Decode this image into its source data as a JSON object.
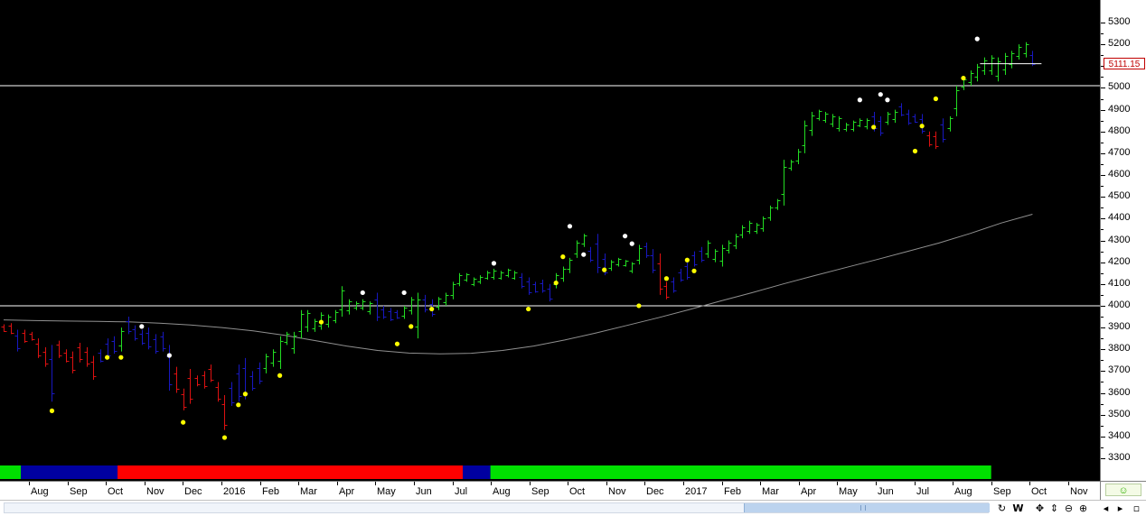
{
  "chart_data": {
    "type": "ohlc",
    "ylim": [
      3300,
      5340
    ],
    "y_ticks": [
      3300,
      3400,
      3500,
      3600,
      3700,
      3800,
      3900,
      4000,
      4100,
      4200,
      4300,
      4400,
      4500,
      4600,
      4700,
      4800,
      4900,
      5000,
      5100,
      5200,
      5300
    ],
    "x_labels": [
      "Aug",
      "Sep",
      "Oct",
      "Nov",
      "Dec",
      "2016",
      "Feb",
      "Mar",
      "Apr",
      "May",
      "Jun",
      "Jul",
      "Aug",
      "Sep",
      "Oct",
      "Nov",
      "Dec",
      "2017",
      "Feb",
      "Mar",
      "Apr",
      "May",
      "Jun",
      "Jul",
      "Aug",
      "Sep",
      "Oct",
      "Nov"
    ],
    "horizontal_lines": [
      4000,
      5010
    ],
    "last_price_label": "5111.15",
    "last_price": 5111.15,
    "colors": {
      "up": "#22dd22",
      "down": "#dd1111",
      "neutral": "#1818c0",
      "ma": "#909090",
      "sar_bull": "#ffff00",
      "sar_bear": "#ffffff",
      "hline": "#ffffff"
    },
    "bars": [
      {
        "h": 3915,
        "l": 3880,
        "d": "d"
      },
      {
        "h": 3920,
        "l": 3870,
        "d": "d"
      },
      {
        "h": 3890,
        "l": 3790,
        "d": "n"
      },
      {
        "h": 3890,
        "l": 3830,
        "d": "d"
      },
      {
        "h": 3880,
        "l": 3840,
        "d": "d"
      },
      {
        "h": 3850,
        "l": 3760,
        "d": "d"
      },
      {
        "h": 3810,
        "l": 3720,
        "d": "d"
      },
      {
        "h": 3820,
        "l": 3560,
        "d": "n"
      },
      {
        "h": 3840,
        "l": 3760,
        "d": "d"
      },
      {
        "h": 3800,
        "l": 3740,
        "d": "d"
      },
      {
        "h": 3790,
        "l": 3690,
        "d": "d"
      },
      {
        "h": 3830,
        "l": 3740,
        "d": "d"
      },
      {
        "h": 3810,
        "l": 3720,
        "d": "d"
      },
      {
        "h": 3770,
        "l": 3660,
        "d": "d"
      },
      {
        "h": 3800,
        "l": 3740,
        "d": "n"
      },
      {
        "h": 3850,
        "l": 3760,
        "d": "n"
      },
      {
        "h": 3860,
        "l": 3780,
        "d": "n"
      },
      {
        "h": 3900,
        "l": 3790,
        "d": "u"
      },
      {
        "h": 3950,
        "l": 3870,
        "d": "n"
      },
      {
        "h": 3910,
        "l": 3840,
        "d": "n"
      },
      {
        "h": 3890,
        "l": 3820,
        "d": "n"
      },
      {
        "h": 3900,
        "l": 3800,
        "d": "n"
      },
      {
        "h": 3870,
        "l": 3780,
        "d": "n"
      },
      {
        "h": 3880,
        "l": 3790,
        "d": "n"
      },
      {
        "h": 3820,
        "l": 3610,
        "d": "n"
      },
      {
        "h": 3720,
        "l": 3600,
        "d": "d"
      },
      {
        "h": 3620,
        "l": 3520,
        "d": "d"
      },
      {
        "h": 3710,
        "l": 3550,
        "d": "d"
      },
      {
        "h": 3680,
        "l": 3630,
        "d": "d"
      },
      {
        "h": 3700,
        "l": 3620,
        "d": "d"
      },
      {
        "h": 3730,
        "l": 3650,
        "d": "d"
      },
      {
        "h": 3650,
        "l": 3560,
        "d": "d"
      },
      {
        "h": 3590,
        "l": 3430,
        "d": "d"
      },
      {
        "h": 3650,
        "l": 3540,
        "d": "n"
      },
      {
        "h": 3730,
        "l": 3560,
        "d": "n"
      },
      {
        "h": 3760,
        "l": 3570,
        "d": "n"
      },
      {
        "h": 3700,
        "l": 3610,
        "d": "n"
      },
      {
        "h": 3740,
        "l": 3640,
        "d": "n"
      },
      {
        "h": 3780,
        "l": 3690,
        "d": "u"
      },
      {
        "h": 3800,
        "l": 3720,
        "d": "u"
      },
      {
        "h": 3860,
        "l": 3710,
        "d": "u"
      },
      {
        "h": 3880,
        "l": 3820,
        "d": "u"
      },
      {
        "h": 3880,
        "l": 3780,
        "d": "u"
      },
      {
        "h": 3980,
        "l": 3850,
        "d": "u"
      },
      {
        "h": 3980,
        "l": 3880,
        "d": "u"
      },
      {
        "h": 3940,
        "l": 3880,
        "d": "u"
      },
      {
        "h": 3970,
        "l": 3890,
        "d": "u"
      },
      {
        "h": 3960,
        "l": 3900,
        "d": "u"
      },
      {
        "h": 3980,
        "l": 3920,
        "d": "u"
      },
      {
        "h": 4090,
        "l": 3950,
        "d": "u"
      },
      {
        "h": 4030,
        "l": 3960,
        "d": "u"
      },
      {
        "h": 4020,
        "l": 3980,
        "d": "u"
      },
      {
        "h": 4030,
        "l": 3980,
        "d": "u"
      },
      {
        "h": 4020,
        "l": 3960,
        "d": "u"
      },
      {
        "h": 4060,
        "l": 3930,
        "d": "n"
      },
      {
        "h": 4000,
        "l": 3940,
        "d": "n"
      },
      {
        "h": 3990,
        "l": 3930,
        "d": "n"
      },
      {
        "h": 3980,
        "l": 3940,
        "d": "n"
      },
      {
        "h": 4000,
        "l": 3940,
        "d": "u"
      },
      {
        "h": 4040,
        "l": 3960,
        "d": "u"
      },
      {
        "h": 4060,
        "l": 3850,
        "d": "u"
      },
      {
        "h": 4050,
        "l": 3970,
        "d": "n"
      },
      {
        "h": 4030,
        "l": 3950,
        "d": "n"
      },
      {
        "h": 4040,
        "l": 3980,
        "d": "u"
      },
      {
        "h": 4060,
        "l": 4000,
        "d": "u"
      },
      {
        "h": 4110,
        "l": 4030,
        "d": "u"
      },
      {
        "h": 4150,
        "l": 4090,
        "d": "u"
      },
      {
        "h": 4150,
        "l": 4110,
        "d": "u"
      },
      {
        "h": 4130,
        "l": 4090,
        "d": "u"
      },
      {
        "h": 4140,
        "l": 4100,
        "d": "u"
      },
      {
        "h": 4160,
        "l": 4120,
        "d": "u"
      },
      {
        "h": 4170,
        "l": 4120,
        "d": "u"
      },
      {
        "h": 4160,
        "l": 4120,
        "d": "u"
      },
      {
        "h": 4170,
        "l": 4130,
        "d": "u"
      },
      {
        "h": 4160,
        "l": 4120,
        "d": "u"
      },
      {
        "h": 4150,
        "l": 4080,
        "d": "n"
      },
      {
        "h": 4130,
        "l": 4050,
        "d": "n"
      },
      {
        "h": 4110,
        "l": 4060,
        "d": "n"
      },
      {
        "h": 4120,
        "l": 4060,
        "d": "n"
      },
      {
        "h": 4100,
        "l": 4020,
        "d": "n"
      },
      {
        "h": 4150,
        "l": 4080,
        "d": "u"
      },
      {
        "h": 4180,
        "l": 4110,
        "d": "u"
      },
      {
        "h": 4220,
        "l": 4150,
        "d": "u"
      },
      {
        "h": 4300,
        "l": 4220,
        "d": "u"
      },
      {
        "h": 4330,
        "l": 4270,
        "d": "u"
      },
      {
        "h": 4270,
        "l": 4200,
        "d": "n"
      },
      {
        "h": 4330,
        "l": 4150,
        "d": "n"
      },
      {
        "h": 4240,
        "l": 4140,
        "d": "n"
      },
      {
        "h": 4210,
        "l": 4160,
        "d": "u"
      },
      {
        "h": 4220,
        "l": 4180,
        "d": "u"
      },
      {
        "h": 4210,
        "l": 4180,
        "d": "u"
      },
      {
        "h": 4200,
        "l": 4150,
        "d": "u"
      },
      {
        "h": 4280,
        "l": 4190,
        "d": "u"
      },
      {
        "h": 4290,
        "l": 4220,
        "d": "n"
      },
      {
        "h": 4260,
        "l": 4150,
        "d": "n"
      },
      {
        "h": 4240,
        "l": 4050,
        "d": "d"
      },
      {
        "h": 4110,
        "l": 4030,
        "d": "d"
      },
      {
        "h": 4130,
        "l": 4060,
        "d": "n"
      },
      {
        "h": 4170,
        "l": 4110,
        "d": "n"
      },
      {
        "h": 4200,
        "l": 4120,
        "d": "n"
      },
      {
        "h": 4250,
        "l": 4180,
        "d": "n"
      },
      {
        "h": 4270,
        "l": 4200,
        "d": "n"
      },
      {
        "h": 4300,
        "l": 4220,
        "d": "u"
      },
      {
        "h": 4260,
        "l": 4200,
        "d": "u"
      },
      {
        "h": 4280,
        "l": 4180,
        "d": "u"
      },
      {
        "h": 4300,
        "l": 4240,
        "d": "u"
      },
      {
        "h": 4330,
        "l": 4260,
        "d": "u"
      },
      {
        "h": 4370,
        "l": 4310,
        "d": "u"
      },
      {
        "h": 4390,
        "l": 4330,
        "d": "u"
      },
      {
        "h": 4380,
        "l": 4330,
        "d": "u"
      },
      {
        "h": 4410,
        "l": 4340,
        "d": "u"
      },
      {
        "h": 4460,
        "l": 4390,
        "d": "u"
      },
      {
        "h": 4490,
        "l": 4440,
        "d": "u"
      },
      {
        "h": 4670,
        "l": 4460,
        "d": "u"
      },
      {
        "h": 4670,
        "l": 4620,
        "d": "u"
      },
      {
        "h": 4720,
        "l": 4650,
        "d": "u"
      },
      {
        "h": 4850,
        "l": 4700,
        "d": "u"
      },
      {
        "h": 4890,
        "l": 4780,
        "d": "u"
      },
      {
        "h": 4900,
        "l": 4850,
        "d": "u"
      },
      {
        "h": 4890,
        "l": 4840,
        "d": "u"
      },
      {
        "h": 4880,
        "l": 4820,
        "d": "u"
      },
      {
        "h": 4870,
        "l": 4800,
        "d": "u"
      },
      {
        "h": 4840,
        "l": 4800,
        "d": "u"
      },
      {
        "h": 4850,
        "l": 4800,
        "d": "u"
      },
      {
        "h": 4860,
        "l": 4820,
        "d": "u"
      },
      {
        "h": 4860,
        "l": 4810,
        "d": "u"
      },
      {
        "h": 4890,
        "l": 4800,
        "d": "n"
      },
      {
        "h": 4870,
        "l": 4780,
        "d": "n"
      },
      {
        "h": 4890,
        "l": 4830,
        "d": "u"
      },
      {
        "h": 4900,
        "l": 4840,
        "d": "u"
      },
      {
        "h": 4930,
        "l": 4870,
        "d": "n"
      },
      {
        "h": 4900,
        "l": 4830,
        "d": "n"
      },
      {
        "h": 4880,
        "l": 4840,
        "d": "n"
      },
      {
        "h": 4880,
        "l": 4790,
        "d": "n"
      },
      {
        "h": 4800,
        "l": 4730,
        "d": "d"
      },
      {
        "h": 4800,
        "l": 4720,
        "d": "d"
      },
      {
        "h": 4860,
        "l": 4750,
        "d": "n"
      },
      {
        "h": 4870,
        "l": 4800,
        "d": "u"
      },
      {
        "h": 5010,
        "l": 4870,
        "d": "u"
      },
      {
        "h": 5050,
        "l": 4990,
        "d": "u"
      },
      {
        "h": 5080,
        "l": 5010,
        "d": "u"
      },
      {
        "h": 5110,
        "l": 5030,
        "d": "u"
      },
      {
        "h": 5140,
        "l": 5060,
        "d": "u"
      },
      {
        "h": 5150,
        "l": 5060,
        "d": "u"
      },
      {
        "h": 5140,
        "l": 5030,
        "d": "u"
      },
      {
        "h": 5160,
        "l": 5060,
        "d": "u"
      },
      {
        "h": 5170,
        "l": 5090,
        "d": "u"
      },
      {
        "h": 5200,
        "l": 5130,
        "d": "u"
      },
      {
        "h": 5210,
        "l": 5140,
        "d": "u"
      },
      {
        "h": 5170,
        "l": 5100,
        "d": "n"
      }
    ],
    "moving_average": [
      3935,
      3932,
      3930,
      3928,
      3926,
      3920,
      3912,
      3900,
      3885,
      3865,
      3840,
      3815,
      3795,
      3783,
      3779,
      3782,
      3795,
      3815,
      3843,
      3875,
      3910,
      3945,
      3983,
      4022,
      4060,
      4100,
      4138,
      4175,
      4212,
      4250,
      4288,
      4332,
      4380,
      4420
    ],
    "sar_points": [
      {
        "i": 7,
        "v": 3518,
        "t": "bull"
      },
      {
        "i": 15,
        "v": 3763,
        "t": "bull"
      },
      {
        "i": 17,
        "v": 3763,
        "t": "bull"
      },
      {
        "i": 20,
        "v": 3905,
        "t": "bear"
      },
      {
        "i": 24,
        "v": 3772,
        "t": "bear"
      },
      {
        "i": 26,
        "v": 3465,
        "t": "bull"
      },
      {
        "i": 32,
        "v": 3395,
        "t": "bull"
      },
      {
        "i": 34,
        "v": 3545,
        "t": "bull"
      },
      {
        "i": 35,
        "v": 3595,
        "t": "bull"
      },
      {
        "i": 40,
        "v": 3680,
        "t": "bull"
      },
      {
        "i": 46,
        "v": 3925,
        "t": "bull"
      },
      {
        "i": 52,
        "v": 4060,
        "t": "bear"
      },
      {
        "i": 57,
        "v": 3825,
        "t": "bull"
      },
      {
        "i": 58,
        "v": 4060,
        "t": "bear"
      },
      {
        "i": 59,
        "v": 3905,
        "t": "bull"
      },
      {
        "i": 62,
        "v": 3985,
        "t": "bull"
      },
      {
        "i": 71,
        "v": 4195,
        "t": "bear"
      },
      {
        "i": 76,
        "v": 3985,
        "t": "bull"
      },
      {
        "i": 80,
        "v": 4105,
        "t": "bull"
      },
      {
        "i": 81,
        "v": 4225,
        "t": "bull"
      },
      {
        "i": 82,
        "v": 4365,
        "t": "bear"
      },
      {
        "i": 84,
        "v": 4235,
        "t": "bear"
      },
      {
        "i": 87,
        "v": 4165,
        "t": "bull"
      },
      {
        "i": 90,
        "v": 4320,
        "t": "bear"
      },
      {
        "i": 91,
        "v": 4285,
        "t": "bear"
      },
      {
        "i": 92,
        "v": 4000,
        "t": "bull"
      },
      {
        "i": 96,
        "v": 4125,
        "t": "bull"
      },
      {
        "i": 99,
        "v": 4210,
        "t": "bull"
      },
      {
        "i": 100,
        "v": 4160,
        "t": "bull"
      },
      {
        "i": 124,
        "v": 4945,
        "t": "bear"
      },
      {
        "i": 126,
        "v": 4820,
        "t": "bull"
      },
      {
        "i": 127,
        "v": 4970,
        "t": "bear"
      },
      {
        "i": 128,
        "v": 4945,
        "t": "bear"
      },
      {
        "i": 132,
        "v": 4710,
        "t": "bull"
      },
      {
        "i": 133,
        "v": 4825,
        "t": "bull"
      },
      {
        "i": 135,
        "v": 4950,
        "t": "bull"
      },
      {
        "i": 139,
        "v": 5045,
        "t": "bull"
      },
      {
        "i": 141,
        "v": 5225,
        "t": "bear"
      }
    ],
    "regime_bar": [
      {
        "from": 0,
        "to": 3,
        "c": "#00e000"
      },
      {
        "from": 3,
        "to": 17,
        "c": "#0000a0"
      },
      {
        "from": 17,
        "to": 67,
        "c": "#ff0000"
      },
      {
        "from": 67,
        "to": 71,
        "c": "#0000a0"
      },
      {
        "from": 71,
        "to": 143,
        "c": "#00e000"
      }
    ]
  },
  "toolbar": {
    "w_label": "W",
    "icons": [
      "refresh-icon",
      "w-icon",
      "pan-icon",
      "scale-icon",
      "zoom-out-icon",
      "zoom-in-icon",
      "scroll-left-icon",
      "scroll-right-icon",
      "maximize-icon"
    ]
  }
}
